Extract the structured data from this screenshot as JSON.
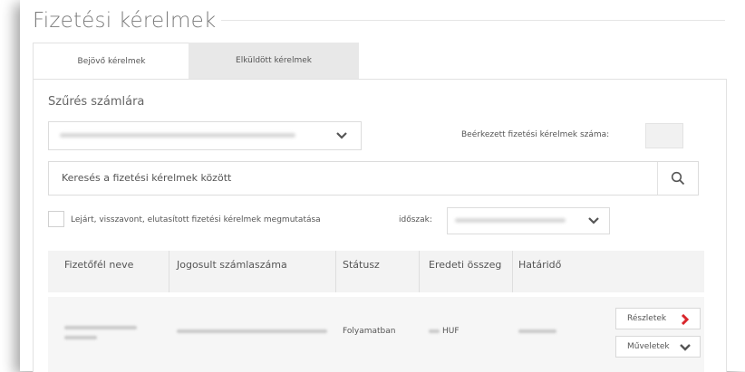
{
  "page": {
    "title": "Fizetési kérelmek"
  },
  "tabs": [
    {
      "label": "Bejövő kérelmek",
      "active": true
    },
    {
      "label": "Elküldött kérelmek",
      "active": false
    }
  ],
  "filter": {
    "label": "Szűrés számlára",
    "received_label": "Beérkezett fizetési kérelmek száma:"
  },
  "search": {
    "placeholder": "Keresés a fizetési kérelmek között"
  },
  "options": {
    "show_expired_label": "Lejárt, visszavont, elutasított fizetési kérelmek megmutatása",
    "period_label": "időszak:"
  },
  "table": {
    "headers": [
      "Fizetőfél neve",
      "Jogosult számlaszáma",
      "Státusz",
      "Eredeti összeg",
      "Határidő"
    ],
    "rows": [
      {
        "status": "Folyamatban",
        "currency": "HUF",
        "details_label": "Részletek",
        "actions_label": "Műveletek"
      }
    ]
  },
  "colors": {
    "accent": "#d9262c",
    "header_bg": "#f3f3f3",
    "tab_inactive_bg": "#e8e8e8"
  }
}
